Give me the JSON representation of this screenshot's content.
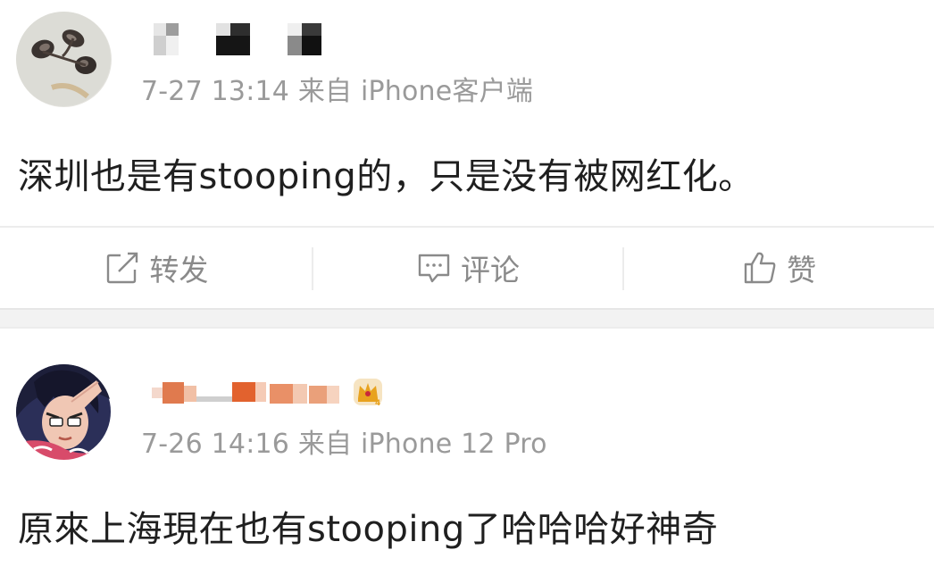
{
  "posts": [
    {
      "meta": "7-27 13:14 来自 iPhone客户端",
      "content": "深圳也是有stooping的，只是没有被网红化。",
      "actions": {
        "repost_label": "转发",
        "comment_label": "评论",
        "like_label": "赞"
      }
    },
    {
      "meta": "7-26 14:16 来自 iPhone 12 Pro",
      "content": "原來上海現在也有stooping了哈哈哈好神奇"
    }
  ],
  "colors": {
    "meta_text": "#9a9a9a",
    "content_text": "#1f1f1f",
    "action_text": "#8a8a8a",
    "divider": "#ececec",
    "crown_badge": "#e8a21e"
  },
  "icons": [
    "repost-icon",
    "comment-icon",
    "like-icon",
    "vip-crown-icon"
  ]
}
